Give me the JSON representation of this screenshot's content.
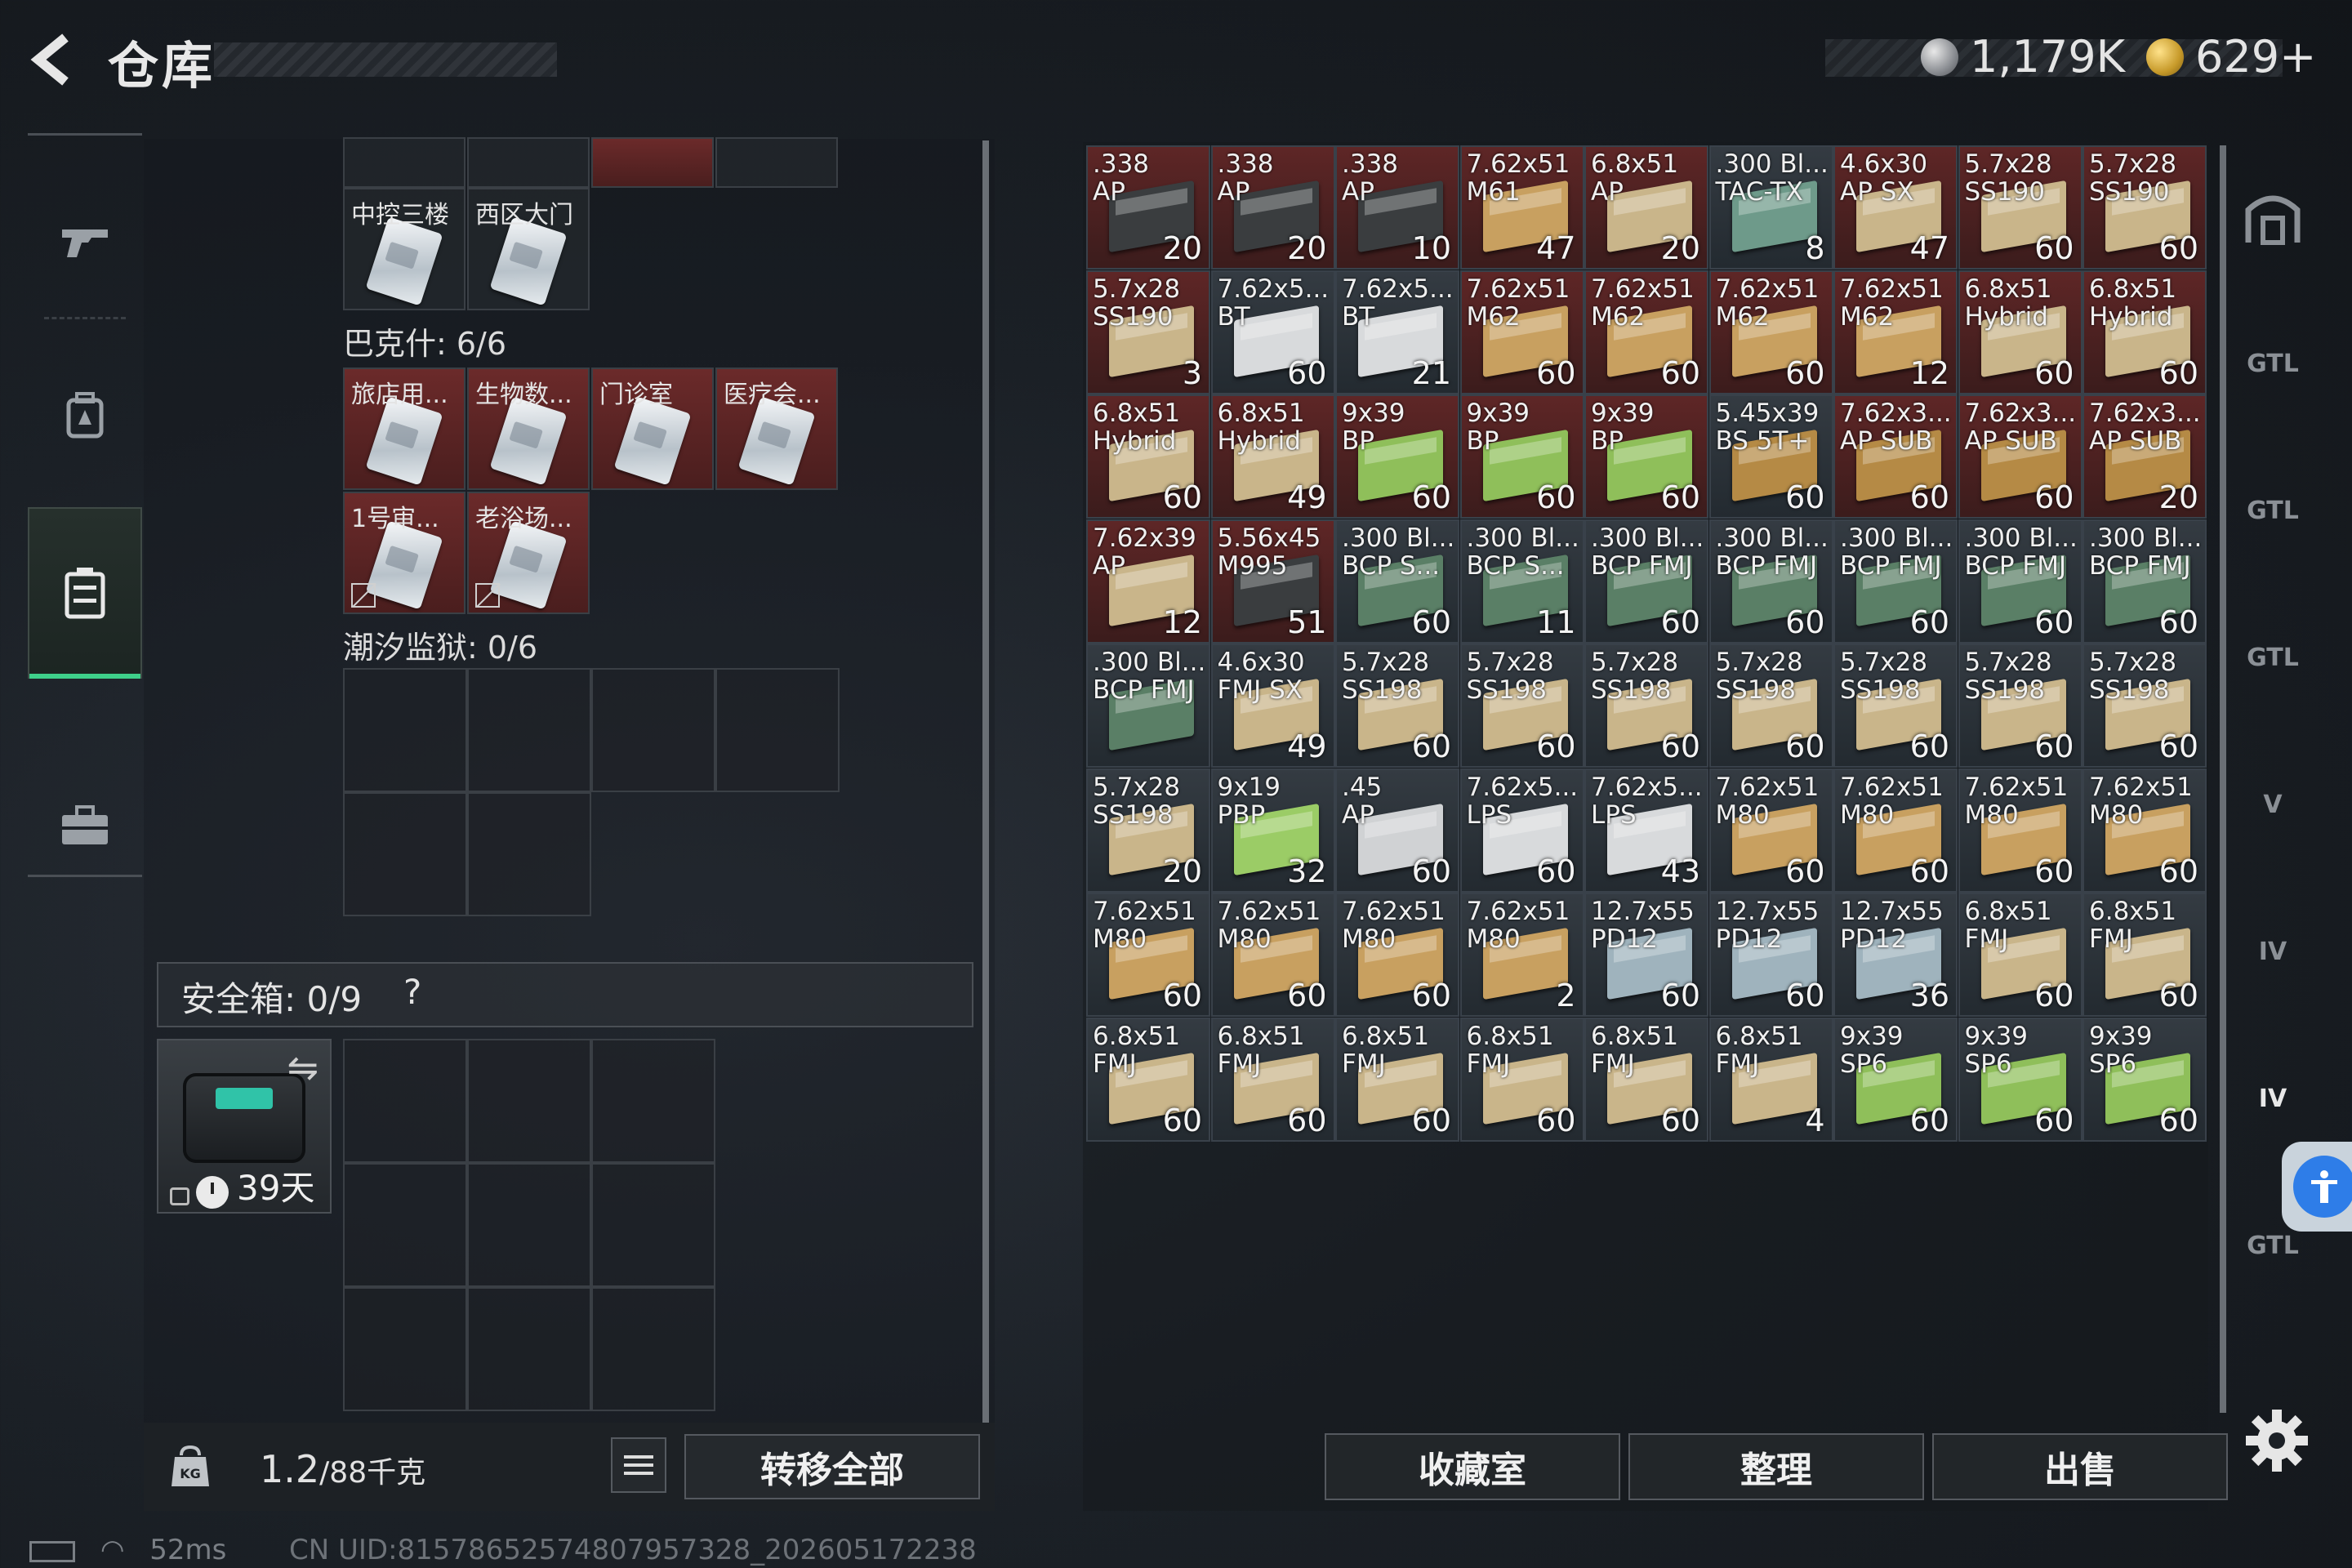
{
  "header": {
    "title": "仓库",
    "currency": [
      {
        "icon": "silver-coin-icon",
        "value": "1,179K"
      },
      {
        "icon": "gold-coin-icon",
        "value": "629+"
      }
    ]
  },
  "left_nav": [
    "gun-icon",
    "backpack-icon",
    "case-icon",
    "briefcase-icon"
  ],
  "keys": {
    "top_row_labels": [
      "中控三楼",
      "西区大门"
    ],
    "group_bakeshi": {
      "title": "巴克什: 6/6",
      "row1": [
        "旅店用...",
        "生物数...",
        "门诊室",
        "医疗会..."
      ],
      "row2": [
        "1号审...",
        "老浴场..."
      ]
    },
    "group_tide_prison": {
      "title": "潮汐监狱: 0/6"
    }
  },
  "safebox": {
    "label": "安全箱: 0/9",
    "help": "?",
    "days_left": "39天"
  },
  "footer_left": {
    "weight_value": "1.2",
    "weight_capacity": "/88千克",
    "transfer_all": "转移全部"
  },
  "status": {
    "ping": "52ms",
    "uid": "CN UID:815786525748079573​28_202605172238"
  },
  "ammo_grid": [
    {
      "name": ".338\nAP",
      "count": "20",
      "color": "#3a3d3f",
      "bg": "red"
    },
    {
      "name": ".338\nAP",
      "count": "20",
      "color": "#3a3d3f",
      "bg": "red"
    },
    {
      "name": ".338\nAP",
      "count": "10",
      "color": "#3a3d3f",
      "bg": "red"
    },
    {
      "name": "7.62x51\nM61",
      "count": "47",
      "color": "#c8a060",
      "bg": "red"
    },
    {
      "name": "6.8x51\nAP",
      "count": "20",
      "color": "#c9b58a",
      "bg": "red"
    },
    {
      "name": ".300 Bl...\nTAC-TX",
      "count": "8",
      "color": "#6e9a8a",
      "bg": "grey"
    },
    {
      "name": "4.6x30\nAP SX",
      "count": "47",
      "color": "#c9b58a",
      "bg": "red"
    },
    {
      "name": "5.7x28\nSS190",
      "count": "60",
      "color": "#c9b58a",
      "bg": "red"
    },
    {
      "name": "5.7x28\nSS190",
      "count": "60",
      "color": "#c9b58a",
      "bg": "red"
    },
    {
      "name": "5.7x28\nSS190",
      "count": "3",
      "color": "#c9b58a",
      "bg": "red"
    },
    {
      "name": "7.62x5...\nBT",
      "count": "60",
      "color": "#d8dadc",
      "bg": "grey"
    },
    {
      "name": "7.62x5...\nBT",
      "count": "21",
      "color": "#d8dadc",
      "bg": "grey"
    },
    {
      "name": "7.62x51\nM62",
      "count": "60",
      "color": "#c8a060",
      "bg": "red"
    },
    {
      "name": "7.62x51\nM62",
      "count": "60",
      "color": "#c8a060",
      "bg": "red"
    },
    {
      "name": "7.62x51\nM62",
      "count": "60",
      "color": "#c8a060",
      "bg": "red"
    },
    {
      "name": "7.62x51\nM62",
      "count": "12",
      "color": "#c8a060",
      "bg": "red"
    },
    {
      "name": "6.8x51\nHybrid",
      "count": "60",
      "color": "#c9b58a",
      "bg": "red"
    },
    {
      "name": "6.8x51\nHybrid",
      "count": "60",
      "color": "#c9b58a",
      "bg": "red"
    },
    {
      "name": "6.8x51\nHybrid",
      "count": "60",
      "color": "#c9b58a",
      "bg": "red"
    },
    {
      "name": "6.8x51\nHybrid",
      "count": "49",
      "color": "#c9b58a",
      "bg": "red"
    },
    {
      "name": "9x39\nBP",
      "count": "60",
      "color": "#8fbf5a",
      "bg": "red"
    },
    {
      "name": "9x39\nBP",
      "count": "60",
      "color": "#8fbf5a",
      "bg": "red"
    },
    {
      "name": "9x39\nBP",
      "count": "60",
      "color": "#8fbf5a",
      "bg": "red"
    },
    {
      "name": "5.45x39\nBS 5T+",
      "count": "60",
      "color": "#b58a45",
      "bg": "grey"
    },
    {
      "name": "7.62x3...\nAP SUB",
      "count": "60",
      "color": "#b58a45",
      "bg": "red"
    },
    {
      "name": "7.62x3...\nAP SUB",
      "count": "60",
      "color": "#b58a45",
      "bg": "red"
    },
    {
      "name": "7.62x3...\nAP SUB",
      "count": "20",
      "color": "#b58a45",
      "bg": "red"
    },
    {
      "name": "7.62x39\nAP",
      "count": "12",
      "color": "#c9b58a",
      "bg": "red"
    },
    {
      "name": "5.56x45\nM995",
      "count": "51",
      "color": "#3a3d3f",
      "bg": "red"
    },
    {
      "name": ".300 Bl...\nBCP S...",
      "count": "60",
      "color": "#5a7f66",
      "bg": "grey"
    },
    {
      "name": ".300 Bl...\nBCP S...",
      "count": "11",
      "color": "#5a7f66",
      "bg": "grey"
    },
    {
      "name": ".300 Bl...\nBCP FMJ",
      "count": "60",
      "color": "#5a7f66",
      "bg": "grey"
    },
    {
      "name": ".300 Bl...\nBCP FMJ",
      "count": "60",
      "color": "#5a7f66",
      "bg": "grey"
    },
    {
      "name": ".300 Bl...\nBCP FMJ",
      "count": "60",
      "color": "#5a7f66",
      "bg": "grey"
    },
    {
      "name": ".300 Bl...\nBCP FMJ",
      "count": "60",
      "color": "#5a7f66",
      "bg": "grey"
    },
    {
      "name": ".300 Bl...\nBCP FMJ",
      "count": "60",
      "color": "#5a7f66",
      "bg": "grey"
    },
    {
      "name": ".300 Bl...\nBCP FMJ",
      "count": "",
      "color": "#5a7f66",
      "bg": "grey"
    },
    {
      "name": "4.6x30\nFMJ SX",
      "count": "49",
      "color": "#c9b58a",
      "bg": "grey"
    },
    {
      "name": "5.7x28\nSS198",
      "count": "60",
      "color": "#c9b58a",
      "bg": "grey"
    },
    {
      "name": "5.7x28\nSS198",
      "count": "60",
      "color": "#c9b58a",
      "bg": "grey"
    },
    {
      "name": "5.7x28\nSS198",
      "count": "60",
      "color": "#c9b58a",
      "bg": "grey"
    },
    {
      "name": "5.7x28\nSS198",
      "count": "60",
      "color": "#c9b58a",
      "bg": "grey"
    },
    {
      "name": "5.7x28\nSS198",
      "count": "60",
      "color": "#c9b58a",
      "bg": "grey"
    },
    {
      "name": "5.7x28\nSS198",
      "count": "60",
      "color": "#c9b58a",
      "bg": "grey"
    },
    {
      "name": "5.7x28\nSS198",
      "count": "60",
      "color": "#c9b58a",
      "bg": "grey"
    },
    {
      "name": "5.7x28\nSS198",
      "count": "20",
      "color": "#c9b58a",
      "bg": "grey"
    },
    {
      "name": "9x19\nPBP",
      "count": "32",
      "color": "#9bcc66",
      "bg": "grey"
    },
    {
      "name": ".45\nAP",
      "count": "60",
      "color": "#d0d2d4",
      "bg": "grey"
    },
    {
      "name": "7.62x5...\nLPS",
      "count": "60",
      "color": "#d8dadc",
      "bg": "grey"
    },
    {
      "name": "7.62x5...\nLPS",
      "count": "43",
      "color": "#d8dadc",
      "bg": "grey"
    },
    {
      "name": "7.62x51\nM80",
      "count": "60",
      "color": "#c8a060",
      "bg": "grey"
    },
    {
      "name": "7.62x51\nM80",
      "count": "60",
      "color": "#c8a060",
      "bg": "grey"
    },
    {
      "name": "7.62x51\nM80",
      "count": "60",
      "color": "#c8a060",
      "bg": "grey"
    },
    {
      "name": "7.62x51\nM80",
      "count": "60",
      "color": "#c8a060",
      "bg": "grey"
    },
    {
      "name": "7.62x51\nM80",
      "count": "60",
      "color": "#c8a060",
      "bg": "grey"
    },
    {
      "name": "7.62x51\nM80",
      "count": "60",
      "color": "#c8a060",
      "bg": "grey"
    },
    {
      "name": "7.62x51\nM80",
      "count": "60",
      "color": "#c8a060",
      "bg": "grey"
    },
    {
      "name": "7.62x51\nM80",
      "count": "2",
      "color": "#c8a060",
      "bg": "grey"
    },
    {
      "name": "12.7x55\nPD12",
      "count": "60",
      "color": "#9fb3bd",
      "bg": "grey"
    },
    {
      "name": "12.7x55\nPD12",
      "count": "60",
      "color": "#9fb3bd",
      "bg": "grey"
    },
    {
      "name": "12.7x55\nPD12",
      "count": "36",
      "color": "#9fb3bd",
      "bg": "grey"
    },
    {
      "name": "6.8x51\nFMJ",
      "count": "60",
      "color": "#c9b58a",
      "bg": "grey"
    },
    {
      "name": "6.8x51\nFMJ",
      "count": "60",
      "color": "#c9b58a",
      "bg": "grey"
    },
    {
      "name": "6.8x51\nFMJ",
      "count": "60",
      "color": "#c9b58a",
      "bg": "grey"
    },
    {
      "name": "6.8x51\nFMJ",
      "count": "60",
      "color": "#c9b58a",
      "bg": "grey"
    },
    {
      "name": "6.8x51\nFMJ",
      "count": "60",
      "color": "#c9b58a",
      "bg": "grey"
    },
    {
      "name": "6.8x51\nFMJ",
      "count": "60",
      "color": "#c9b58a",
      "bg": "grey"
    },
    {
      "name": "6.8x51\nFMJ",
      "count": "60",
      "color": "#c9b58a",
      "bg": "grey"
    },
    {
      "name": "6.8x51\nFMJ",
      "count": "4",
      "color": "#c9b58a",
      "bg": "grey"
    },
    {
      "name": "9x39\nSP6",
      "count": "60",
      "color": "#8fbf5a",
      "bg": "grey"
    },
    {
      "name": "9x39\nSP6",
      "count": "60",
      "color": "#8fbf5a",
      "bg": "grey"
    },
    {
      "name": "9x39\nSP6",
      "count": "60",
      "color": "#8fbf5a",
      "bg": "grey"
    }
  ],
  "right_buttons": [
    "收藏室",
    "整理",
    "出售"
  ],
  "right_nav": [
    {
      "icon": "house-icon",
      "label": ""
    },
    {
      "icon": "gtl-stash-icon",
      "label": "GTL"
    },
    {
      "icon": "gtl-stash-icon",
      "label": "GTL"
    },
    {
      "icon": "gtl-stash-icon",
      "label": "GTL"
    },
    {
      "icon": "stash-v-icon",
      "label": "V"
    },
    {
      "icon": "stash-iv-add-icon",
      "label": "IV"
    },
    {
      "icon": "stash-iv-icon",
      "label": "IV"
    },
    {
      "icon": "gtl-stash-icon",
      "label": "GTL"
    }
  ],
  "colors": {
    "accent_green": "#3ed08a",
    "rare_red": "#5e2626",
    "accessibility_blue": "#2e7de8"
  }
}
